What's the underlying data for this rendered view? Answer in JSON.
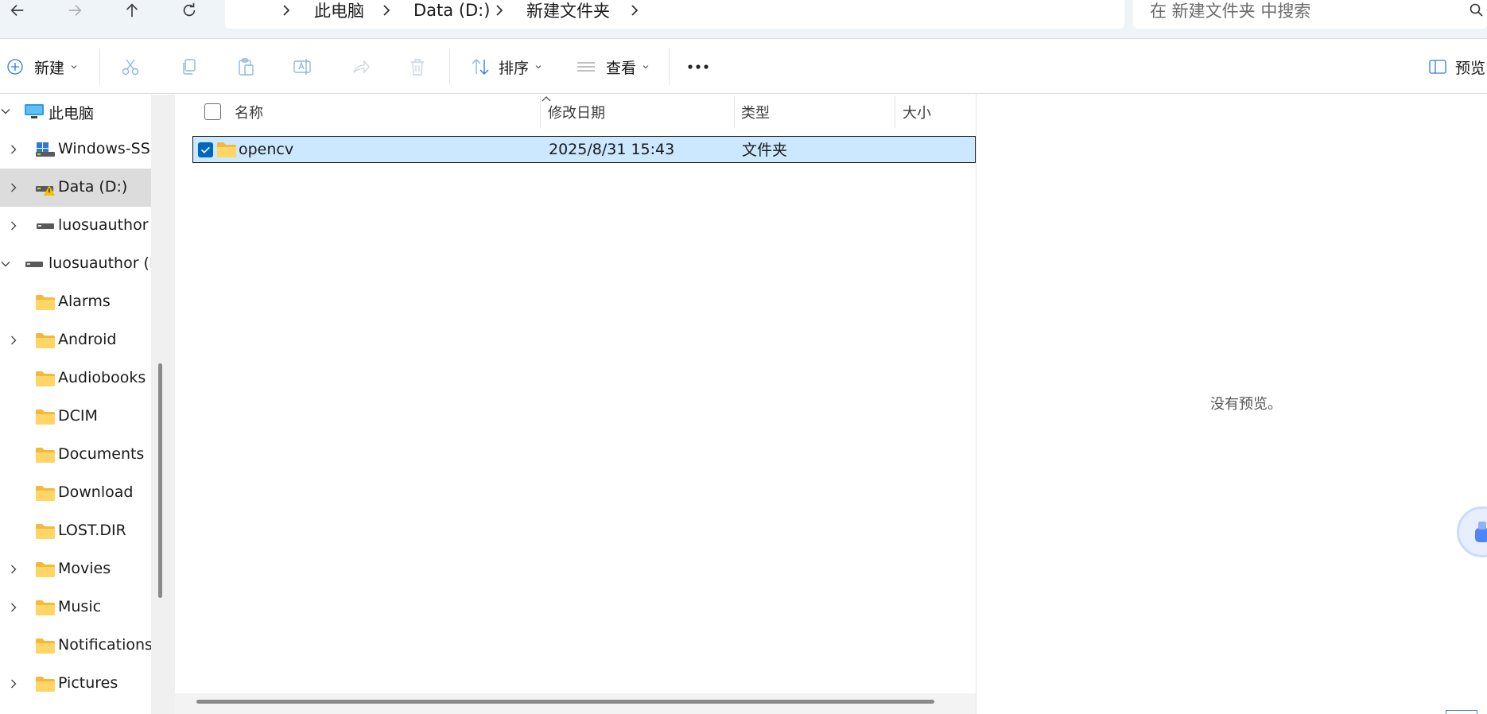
{
  "breadcrumbs": [
    "此电脑",
    "Data (D:)",
    "新建文件夹"
  ],
  "search": {
    "placeholder": "在 新建文件夹 中搜索"
  },
  "toolbar": {
    "new_label": "新建",
    "sort_label": "排序",
    "view_label": "查看",
    "preview_label": "预览"
  },
  "nav": {
    "items": [
      {
        "label": "此电脑",
        "icon": "computer-icon",
        "expander": "expanded"
      },
      {
        "label": "Windows-SSD",
        "icon": "windows-drive-icon",
        "expander": "collapsed"
      },
      {
        "label": "Data (D:)",
        "icon": "warning-drive-icon",
        "expander": "collapsed",
        "selected": true
      },
      {
        "label": "luosuauthor (",
        "icon": "removable-drive-icon",
        "expander": "collapsed"
      },
      {
        "label": "luosuauthor (E:",
        "icon": "removable-drive-icon",
        "expander": "expanded"
      },
      {
        "label": "Alarms",
        "icon": "folder-icon",
        "expander": "none"
      },
      {
        "label": "Android",
        "icon": "folder-icon",
        "expander": "collapsed"
      },
      {
        "label": "Audiobooks",
        "icon": "folder-icon",
        "expander": "none"
      },
      {
        "label": "DCIM",
        "icon": "folder-icon",
        "expander": "none"
      },
      {
        "label": "Documents",
        "icon": "folder-icon",
        "expander": "none"
      },
      {
        "label": "Download",
        "icon": "folder-icon",
        "expander": "none"
      },
      {
        "label": "LOST.DIR",
        "icon": "folder-icon",
        "expander": "none"
      },
      {
        "label": "Movies",
        "icon": "folder-icon",
        "expander": "collapsed"
      },
      {
        "label": "Music",
        "icon": "folder-icon",
        "expander": "collapsed"
      },
      {
        "label": "Notifications",
        "icon": "folder-icon",
        "expander": "none"
      },
      {
        "label": "Pictures",
        "icon": "folder-icon",
        "expander": "collapsed"
      }
    ]
  },
  "columns": {
    "name": "名称",
    "modified": "修改日期",
    "type": "类型",
    "size": "大小"
  },
  "files": [
    {
      "name": "opencv",
      "modified": "2025/8/31 15:43",
      "type": "文件夹",
      "size": "",
      "selected": true
    }
  ],
  "preview": {
    "empty_text": "没有预览。"
  },
  "colors": {
    "accent": "#0067c0",
    "selection": "#cce8ff",
    "folder": "#f8c84a",
    "chrome": "#eff4f9"
  }
}
